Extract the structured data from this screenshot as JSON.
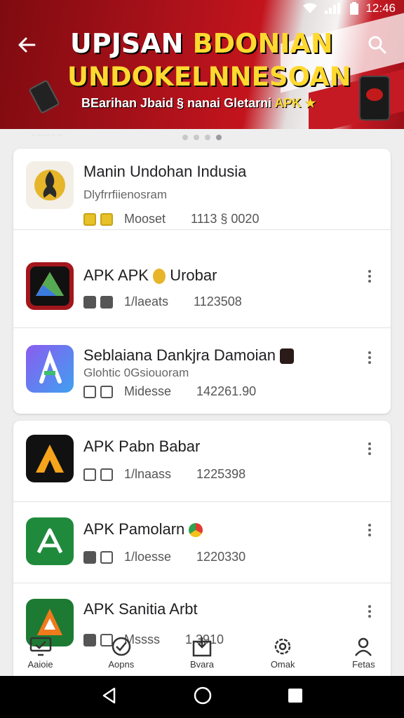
{
  "status_bar": {
    "time": "12:46"
  },
  "banner": {
    "title_line1_white": "UPJSAN",
    "title_line1_yellow": "BDONIAN",
    "title_line2": "UNDOKELNNESOAN",
    "subtitle": "BEarihan Jbaid § nanai Gletarni",
    "subtitle_apk": "APK",
    "carousel_caption": "·· ······· ·· ···"
  },
  "card1": {
    "rows": [
      {
        "name": "Manin Undohan Indusia",
        "developer": "Dlyfrrfiienosram",
        "label": "Mooset",
        "size": "1113 § 0020",
        "icon": "garuda-emblem-icon"
      },
      {
        "name": "APK APK",
        "name_suffix": "Urobar",
        "label": "1/laeats",
        "size": "1123508",
        "icon": "drive-triangle-icon"
      },
      {
        "name": "Seblaiana Dankjra Damoian",
        "developer": "Glohtic 0Gsiouoram",
        "label": "Midesse",
        "size": "142261.90",
        "icon": "gradient-a-icon"
      }
    ]
  },
  "card2": {
    "rows": [
      {
        "name": "APK Pabn Babar",
        "label": "1/lnaass",
        "size": "1225398",
        "icon": "orange-a-icon"
      },
      {
        "name": "APK Pamolarn",
        "label": "1/loesse",
        "size": "1220330",
        "icon": "green-a-icon"
      },
      {
        "name": "APK Sanitia Arbt",
        "label": "Mssss",
        "size": "1.3910",
        "icon": "orange-green-a-icon"
      }
    ]
  },
  "bottom_nav": [
    {
      "label": "Aaioie",
      "icon": "monitor-check-icon"
    },
    {
      "label": "Aopns",
      "icon": "badge-check-icon"
    },
    {
      "label": "Bvara",
      "icon": "download-box-icon"
    },
    {
      "label": "Omak",
      "icon": "gear-badge-icon"
    },
    {
      "label": "Fetas",
      "icon": "person-icon"
    }
  ],
  "colors": {
    "banner_red": "#b0121b",
    "banner_yellow": "#ffd930",
    "card_bg": "#ffffff",
    "page_bg": "#eeeeef"
  }
}
